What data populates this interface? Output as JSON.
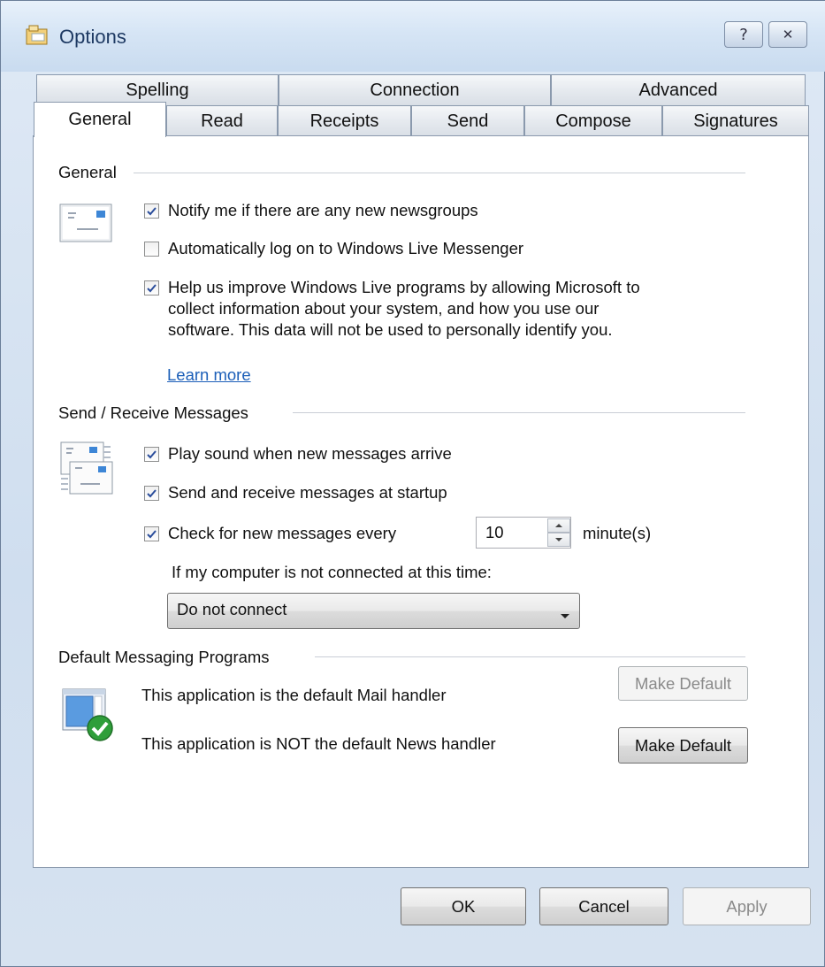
{
  "window": {
    "title": "Options",
    "help_glyph": "?",
    "close_glyph": "✕"
  },
  "tabs_row1": [
    {
      "label": "Spelling"
    },
    {
      "label": "Connection"
    },
    {
      "label": "Advanced"
    }
  ],
  "tabs_row2": [
    {
      "label": "General",
      "active": true
    },
    {
      "label": "Read"
    },
    {
      "label": "Receipts"
    },
    {
      "label": "Send"
    },
    {
      "label": "Compose"
    },
    {
      "label": "Signatures"
    }
  ],
  "general": {
    "heading": "General",
    "icon": "newsgroup-envelope-icon",
    "notify_newsgroups": {
      "label": "Notify me if there are any new newsgroups",
      "checked": true
    },
    "auto_logon": {
      "label": "Automatically log on to Windows Live Messenger",
      "checked": false
    },
    "help_improve": {
      "line1": "Help us improve Windows Live programs by allowing Microsoft to",
      "line2": "collect information about your system, and how you use our",
      "line3": "software. This data will not be used to personally identify you.",
      "checked": true
    },
    "learn_more": "Learn more"
  },
  "send_receive": {
    "heading": "Send / Receive Messages",
    "icon": "messages-icon",
    "play_sound": {
      "label": "Play sound when new messages arrive",
      "checked": true
    },
    "send_receive_startup": {
      "label": "Send and receive messages at startup",
      "checked": true
    },
    "check_every": {
      "label": "Check for new messages every",
      "checked": true,
      "value": "10",
      "unit": "minute(s)"
    },
    "not_connected_label": "If my computer is not connected at this time:",
    "not_connected_value": "Do not connect"
  },
  "default_programs": {
    "heading": "Default Messaging Programs",
    "icon": "default-program-check-icon",
    "mail_text": "This application is the default Mail handler",
    "news_text": "This application is NOT the default News handler",
    "make_default_mail": "Make Default",
    "make_default_news": "Make Default"
  },
  "footer": {
    "ok": "OK",
    "cancel": "Cancel",
    "apply": "Apply"
  },
  "colors": {
    "link": "#1c5fb8",
    "panel_border": "#8a99ad",
    "title_text": "#1e3a63"
  }
}
